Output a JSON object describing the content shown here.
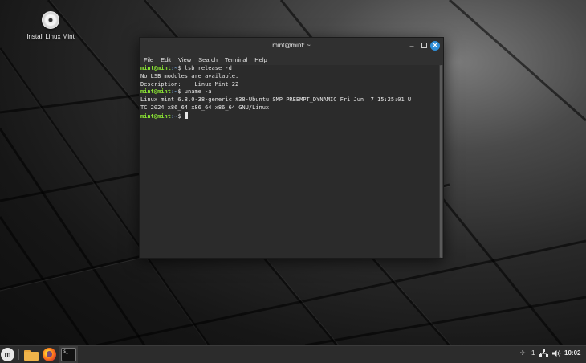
{
  "desktop": {
    "icons": [
      {
        "label": "Install Linux Mint",
        "icon": "disc-icon"
      }
    ]
  },
  "terminal_window": {
    "title": "mint@mint: ~",
    "controls": {
      "minimize": "–",
      "close": "✕"
    },
    "menu": [
      "File",
      "Edit",
      "View",
      "Search",
      "Terminal",
      "Help"
    ],
    "lines": [
      {
        "prompt": "mint@mint",
        "path": ":~",
        "cmd": "$ lsb_release -d"
      },
      {
        "text": "No LSB modules are available."
      },
      {
        "text": "Description:    Linux Mint 22"
      },
      {
        "prompt": "mint@mint",
        "path": ":~",
        "cmd": "$ uname -a"
      },
      {
        "text": "Linux mint 6.8.0-38-generic #38-Ubuntu SMP PREEMPT_DYNAMIC Fri Jun  7 15:25:01 U"
      },
      {
        "text": "TC 2024 x86_64 x86_64 x86_64 GNU/Linux"
      },
      {
        "prompt": "mint@mint",
        "path": ":~",
        "cmd": "$ "
      }
    ]
  },
  "taskbar": {
    "menu_logo": "m",
    "terminal_icon_text": "$_",
    "tray": {
      "notification_count": "1",
      "clock": "10:02"
    },
    "icons": [
      "mint-menu-icon",
      "files-folder-icon",
      "firefox-icon",
      "terminal-icon",
      "pin-icon",
      "network-icon",
      "volume-icon"
    ]
  }
}
